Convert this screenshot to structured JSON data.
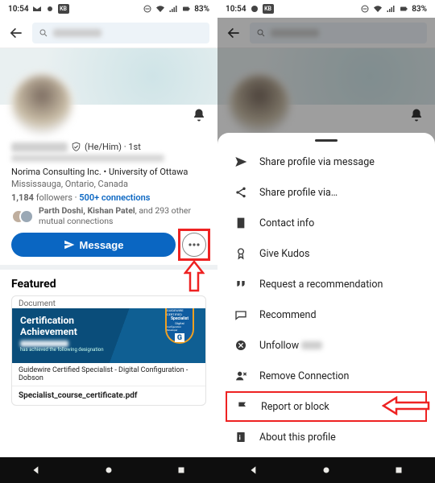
{
  "status": {
    "time": "10:54",
    "battery": "83%"
  },
  "profile": {
    "pronouns": "(He/Him)",
    "degree": "1st",
    "company_line": "Norima Consulting Inc. • University of Ottawa",
    "location": "Mississauga, Ontario, Canada",
    "followers": "1,184",
    "followers_label": "followers",
    "connections": "500+ connections",
    "mutual_names": "Parth Doshi, Kishan Patel",
    "mutual_rest": ", and 293 other mutual connections",
    "message_btn": "Message"
  },
  "featured": {
    "heading": "Featured",
    "doc_type": "Document",
    "cert_line1": "Certification",
    "cert_line2": "Achievement",
    "cert_small": "has achieved the following designation",
    "badge_top": "GUIDEWIRE CERTIFIED",
    "badge_mid": "Specialist",
    "badge_sub1": "Digital",
    "badge_sub2": "Configuration Developer",
    "doc_title": "Guidewire Certified Specialist - Digital Configuration - Dobson",
    "filename": "Specialist_course_certificate.pdf"
  },
  "sheet": {
    "items": [
      "Share profile via message",
      "Share profile via…",
      "Contact info",
      "Give Kudos",
      "Request a recommendation",
      "Recommend",
      "Unfollow",
      "Remove Connection",
      "Report or block",
      "About this profile"
    ]
  }
}
